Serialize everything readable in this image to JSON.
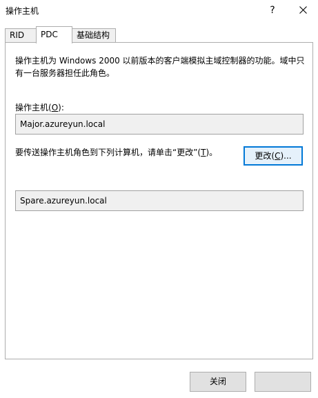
{
  "window": {
    "title": "操作主机",
    "help_label": "?"
  },
  "tabs": [
    {
      "label": "RID"
    },
    {
      "label": "PDC"
    },
    {
      "label": "基础结构"
    }
  ],
  "content": {
    "description_line1": "操作主机为 Windows 2000 以前版本的客户端模拟主域控制器的功能。域中只",
    "description_line2": "有一台服务器担任此角色。",
    "fsmo_label_prefix": "操作主机(",
    "fsmo_label_key": "O",
    "fsmo_label_suffix": "):",
    "current_master": "Major.azureyun.local",
    "transfer_prefix": "要传送操作主机角色到下列计算机，请单击“更改”(",
    "transfer_key": "T",
    "transfer_suffix": ")。",
    "change_prefix": "更改(",
    "change_key": "C",
    "change_suffix": ")...",
    "target_computer": "Spare.azureyun.local"
  },
  "footer": {
    "close_label": "关闭"
  }
}
